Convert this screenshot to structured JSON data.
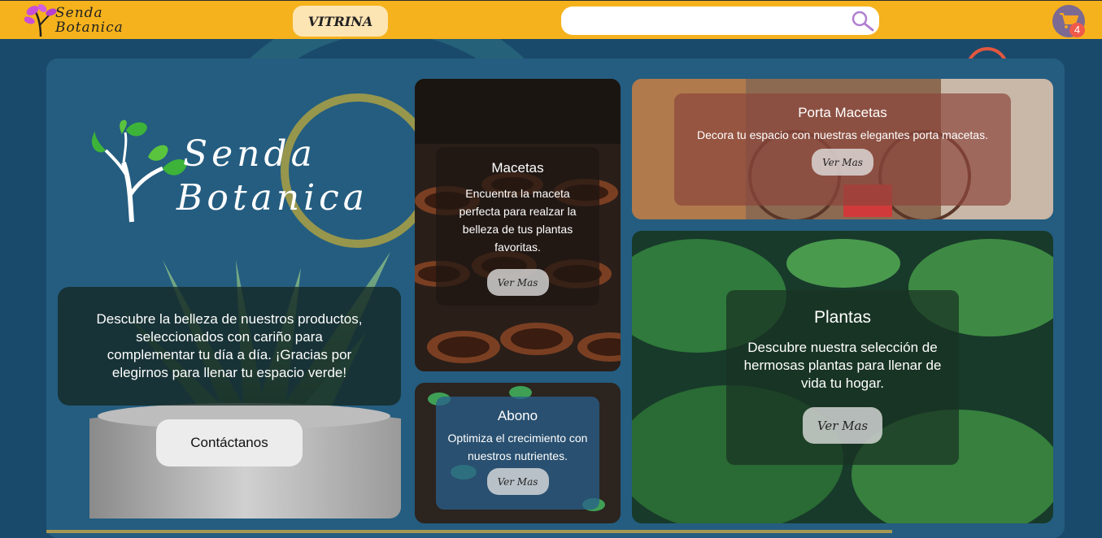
{
  "header": {
    "logo_line1": "Senda",
    "logo_line2": "Botanica",
    "nav_vitrina": "VITRINA",
    "search_placeholder": "",
    "cart_count": "4"
  },
  "hero": {
    "brand_line1": "Senda",
    "brand_line2": "Botanica",
    "intro_text": "Descubre la belleza de nuestros productos, seleccionados con cariño para complementar tu día a día. ¡Gracias por elegirnos para llenar tu espacio verde!",
    "contact_label": "Contáctanos"
  },
  "categories": {
    "macetas": {
      "title": "Macetas",
      "desc": "Encuentra la maceta perfecta para realzar la belleza de tus plantas favoritas.",
      "button": "Ver Mas"
    },
    "porta": {
      "title": "Porta Macetas",
      "desc": "Decora tu espacio con nuestras elegantes porta macetas.",
      "button": "Ver Mas"
    },
    "abono": {
      "title": "Abono",
      "desc": "Optimiza el crecimiento con nuestros nutrientes.",
      "button": "Ver Mas"
    },
    "plantas": {
      "title": "Plantas",
      "desc": "Descubre nuestra selección de hermosas plantas para llenar de vida tu hogar.",
      "button": "Ver Mas"
    }
  },
  "colors": {
    "header_bg": "#f5b21c",
    "page_bg": "#1a4a6b",
    "card_bg": "#245d80"
  }
}
